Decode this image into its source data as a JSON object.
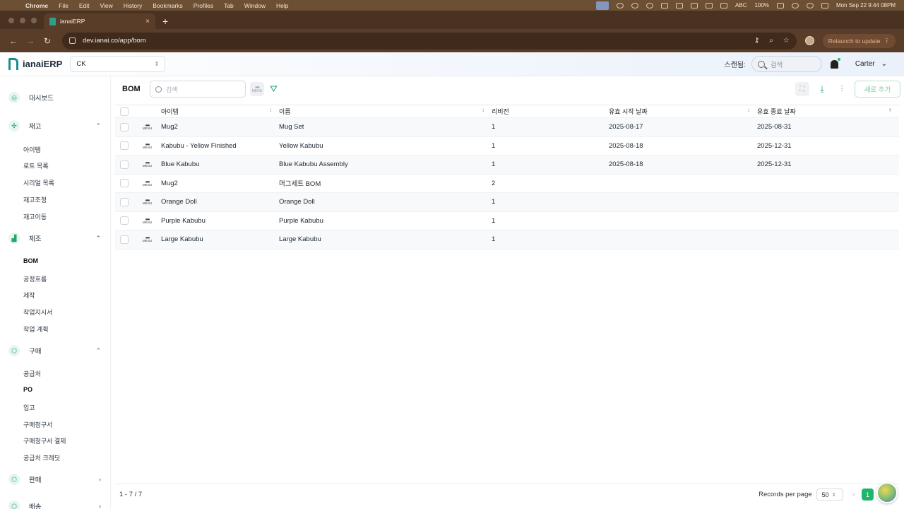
{
  "os_menubar": {
    "app": "Chrome",
    "items": [
      "File",
      "Edit",
      "View",
      "History",
      "Bookmarks",
      "Profiles",
      "Tab",
      "Window",
      "Help"
    ],
    "input_source": "ABC",
    "battery": "100%",
    "datetime": "Mon Sep 22  9:44 08PM"
  },
  "browser": {
    "tab_title": "ianaiERP",
    "new_tab": "+",
    "url": "dev.ianai.co/app/bom",
    "relaunch_label": "Relaunch to update"
  },
  "app_header": {
    "brand": "ianaiERP",
    "company": "CK",
    "scan_label": "스캔됨:",
    "search_placeholder": "검색",
    "user_name": "Carter"
  },
  "sidebar": {
    "dashboard": "대시보드",
    "inventory": "재고",
    "inventory_items": [
      "아이템",
      "로트 목록",
      "시리얼 목록",
      "재고조정",
      "재고이동"
    ],
    "manufacturing": "제조",
    "manufacturing_items": [
      "BOM",
      "공정흐름",
      "제작",
      "작업지시서",
      "작업 계획"
    ],
    "purchasing": "구매",
    "purchasing_items": [
      "공급처",
      "PO",
      "입고",
      "구매청구서",
      "구매청구서 결제",
      "공급처 크레딧"
    ],
    "sales": "판매",
    "shipping": "배송"
  },
  "toolbar": {
    "title": "BOM",
    "search_placeholder": "검색",
    "menu_label": "MENU",
    "add_label": "새로 추가"
  },
  "table": {
    "headers": {
      "item": "아이템",
      "name": "이름",
      "revision": "리비전",
      "start": "유효 시작 날짜",
      "end": "유효 종료 날짜"
    },
    "row_menu_label": "MENU",
    "rows": [
      {
        "item": "Mug2",
        "name": "Mug Set",
        "revision": "1",
        "start": "2025-08-17",
        "end": "2025-08-31"
      },
      {
        "item": "Kabubu - Yellow Finished",
        "name": "Yellow Kabubu",
        "revision": "1",
        "start": "2025-08-18",
        "end": "2025-12-31"
      },
      {
        "item": "Blue Kabubu",
        "name": "Blue Kabubu Assembly",
        "revision": "1",
        "start": "2025-08-18",
        "end": "2025-12-31"
      },
      {
        "item": "Mug2",
        "name": "머그세트 BOM",
        "revision": "2",
        "start": "",
        "end": ""
      },
      {
        "item": "Orange Doll",
        "name": "Orange Doll",
        "revision": "1",
        "start": "",
        "end": ""
      },
      {
        "item": "Purple Kabubu",
        "name": "Purple Kabubu",
        "revision": "1",
        "start": "",
        "end": ""
      },
      {
        "item": "Large Kabubu",
        "name": "Large Kabubu",
        "revision": "1",
        "start": "",
        "end": ""
      }
    ]
  },
  "footer": {
    "range": "1 - 7 / 7",
    "rpp_label": "Records per page",
    "rpp_value": "50",
    "current_page": "1"
  },
  "colors": {
    "accent_green": "#22b36e",
    "brand_teal": "#1c8c8c",
    "browser_frame": "#5a3d29"
  }
}
